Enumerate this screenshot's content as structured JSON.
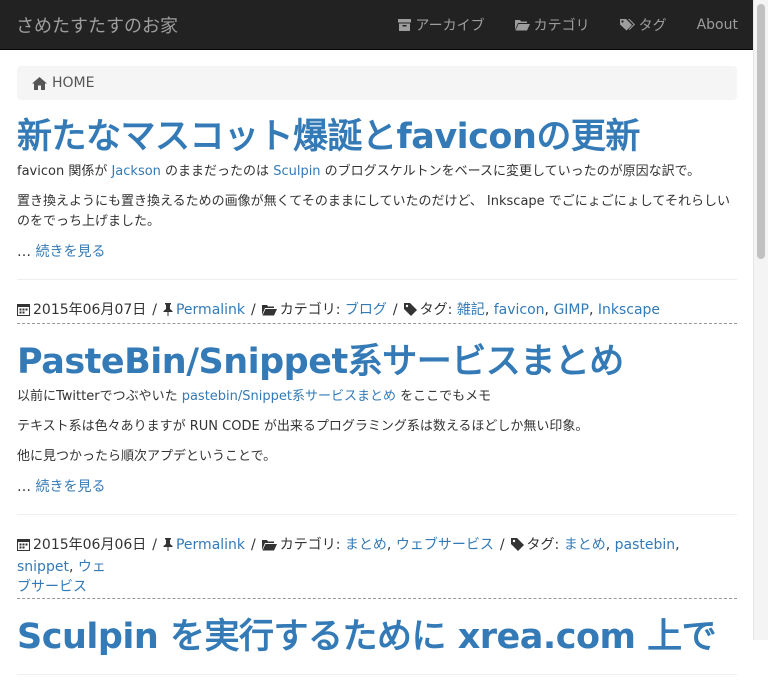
{
  "site": {
    "title": "さめたすたすのお家"
  },
  "nav": {
    "items": [
      {
        "label": "アーカイブ",
        "icon": "archive-icon"
      },
      {
        "label": "カテゴリ",
        "icon": "folder-open-icon"
      },
      {
        "label": "タグ",
        "icon": "tags-icon"
      },
      {
        "label": "About",
        "icon": ""
      }
    ]
  },
  "breadcrumb": {
    "label": "HOME",
    "icon": "home-icon"
  },
  "posts": [
    {
      "title": "新たなマスコット爆誕とfaviconの更新",
      "p1": {
        "a": "favicon 関係が ",
        "link1": "Jackson",
        "b": " のままだったのは ",
        "link2": "Sculpin",
        "c": " のブログスケルトンをベースに変更していったのが原因な訳で。"
      },
      "p2": "置き換えようにも置き換えるための画像が無くてそのままにしていたのだけど、 Inkscape でごにょごにょしてそれらしいのをでっち上げました。",
      "readmore_prefix": "… ",
      "readmore": "続きを見る"
    },
    {
      "meta": {
        "date": "2015年06月07日",
        "permalink": "Permalink",
        "category_label": "カテゴリ:",
        "categories": [
          "ブログ"
        ],
        "tag_label": "タグ:",
        "tags": [
          "雑記",
          "favicon",
          "GIMP",
          "Inkscape"
        ]
      },
      "title": "PasteBin/Snippet系サービスまとめ",
      "p1": {
        "a": "以前にTwitterでつぶやいた ",
        "link1": "pastebin/Snippet系サービスまとめ",
        "b": " をここでもメモ"
      },
      "p2": "テキスト系は色々ありますが RUN CODE が出来るプログラミング系は数えるほどしか無い印象。",
      "p3": "他に見つかったら順次アプデということで。",
      "readmore_prefix": "… ",
      "readmore": "続きを見る"
    },
    {
      "meta": {
        "date": "2015年06月06日",
        "permalink": "Permalink",
        "category_label": "カテゴリ:",
        "categories": [
          "まとめ",
          "ウェブサービス"
        ],
        "tag_label": "タグ:",
        "tags": [
          "まとめ",
          "pastebin",
          "snippet",
          "ウェ",
          "ブサービス"
        ]
      },
      "title": "Sculpin を実行するために xrea.com 上で"
    }
  ],
  "sep": " / ",
  "comma": ", "
}
